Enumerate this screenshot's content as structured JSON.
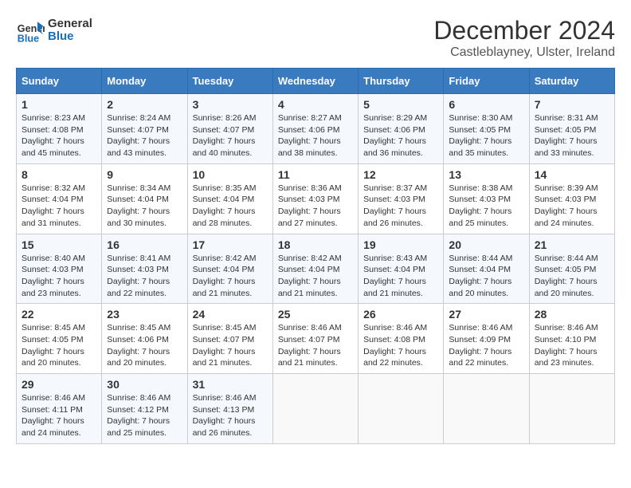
{
  "header": {
    "logo_line1": "General",
    "logo_line2": "Blue",
    "title": "December 2024",
    "subtitle": "Castleblayney, Ulster, Ireland"
  },
  "days_of_week": [
    "Sunday",
    "Monday",
    "Tuesday",
    "Wednesday",
    "Thursday",
    "Friday",
    "Saturday"
  ],
  "weeks": [
    [
      {
        "day": "1",
        "sunrise": "Sunrise: 8:23 AM",
        "sunset": "Sunset: 4:08 PM",
        "daylight": "Daylight: 7 hours and 45 minutes."
      },
      {
        "day": "2",
        "sunrise": "Sunrise: 8:24 AM",
        "sunset": "Sunset: 4:07 PM",
        "daylight": "Daylight: 7 hours and 43 minutes."
      },
      {
        "day": "3",
        "sunrise": "Sunrise: 8:26 AM",
        "sunset": "Sunset: 4:07 PM",
        "daylight": "Daylight: 7 hours and 40 minutes."
      },
      {
        "day": "4",
        "sunrise": "Sunrise: 8:27 AM",
        "sunset": "Sunset: 4:06 PM",
        "daylight": "Daylight: 7 hours and 38 minutes."
      },
      {
        "day": "5",
        "sunrise": "Sunrise: 8:29 AM",
        "sunset": "Sunset: 4:06 PM",
        "daylight": "Daylight: 7 hours and 36 minutes."
      },
      {
        "day": "6",
        "sunrise": "Sunrise: 8:30 AM",
        "sunset": "Sunset: 4:05 PM",
        "daylight": "Daylight: 7 hours and 35 minutes."
      },
      {
        "day": "7",
        "sunrise": "Sunrise: 8:31 AM",
        "sunset": "Sunset: 4:05 PM",
        "daylight": "Daylight: 7 hours and 33 minutes."
      }
    ],
    [
      {
        "day": "8",
        "sunrise": "Sunrise: 8:32 AM",
        "sunset": "Sunset: 4:04 PM",
        "daylight": "Daylight: 7 hours and 31 minutes."
      },
      {
        "day": "9",
        "sunrise": "Sunrise: 8:34 AM",
        "sunset": "Sunset: 4:04 PM",
        "daylight": "Daylight: 7 hours and 30 minutes."
      },
      {
        "day": "10",
        "sunrise": "Sunrise: 8:35 AM",
        "sunset": "Sunset: 4:04 PM",
        "daylight": "Daylight: 7 hours and 28 minutes."
      },
      {
        "day": "11",
        "sunrise": "Sunrise: 8:36 AM",
        "sunset": "Sunset: 4:03 PM",
        "daylight": "Daylight: 7 hours and 27 minutes."
      },
      {
        "day": "12",
        "sunrise": "Sunrise: 8:37 AM",
        "sunset": "Sunset: 4:03 PM",
        "daylight": "Daylight: 7 hours and 26 minutes."
      },
      {
        "day": "13",
        "sunrise": "Sunrise: 8:38 AM",
        "sunset": "Sunset: 4:03 PM",
        "daylight": "Daylight: 7 hours and 25 minutes."
      },
      {
        "day": "14",
        "sunrise": "Sunrise: 8:39 AM",
        "sunset": "Sunset: 4:03 PM",
        "daylight": "Daylight: 7 hours and 24 minutes."
      }
    ],
    [
      {
        "day": "15",
        "sunrise": "Sunrise: 8:40 AM",
        "sunset": "Sunset: 4:03 PM",
        "daylight": "Daylight: 7 hours and 23 minutes."
      },
      {
        "day": "16",
        "sunrise": "Sunrise: 8:41 AM",
        "sunset": "Sunset: 4:03 PM",
        "daylight": "Daylight: 7 hours and 22 minutes."
      },
      {
        "day": "17",
        "sunrise": "Sunrise: 8:42 AM",
        "sunset": "Sunset: 4:04 PM",
        "daylight": "Daylight: 7 hours and 21 minutes."
      },
      {
        "day": "18",
        "sunrise": "Sunrise: 8:42 AM",
        "sunset": "Sunset: 4:04 PM",
        "daylight": "Daylight: 7 hours and 21 minutes."
      },
      {
        "day": "19",
        "sunrise": "Sunrise: 8:43 AM",
        "sunset": "Sunset: 4:04 PM",
        "daylight": "Daylight: 7 hours and 21 minutes."
      },
      {
        "day": "20",
        "sunrise": "Sunrise: 8:44 AM",
        "sunset": "Sunset: 4:04 PM",
        "daylight": "Daylight: 7 hours and 20 minutes."
      },
      {
        "day": "21",
        "sunrise": "Sunrise: 8:44 AM",
        "sunset": "Sunset: 4:05 PM",
        "daylight": "Daylight: 7 hours and 20 minutes."
      }
    ],
    [
      {
        "day": "22",
        "sunrise": "Sunrise: 8:45 AM",
        "sunset": "Sunset: 4:05 PM",
        "daylight": "Daylight: 7 hours and 20 minutes."
      },
      {
        "day": "23",
        "sunrise": "Sunrise: 8:45 AM",
        "sunset": "Sunset: 4:06 PM",
        "daylight": "Daylight: 7 hours and 20 minutes."
      },
      {
        "day": "24",
        "sunrise": "Sunrise: 8:45 AM",
        "sunset": "Sunset: 4:07 PM",
        "daylight": "Daylight: 7 hours and 21 minutes."
      },
      {
        "day": "25",
        "sunrise": "Sunrise: 8:46 AM",
        "sunset": "Sunset: 4:07 PM",
        "daylight": "Daylight: 7 hours and 21 minutes."
      },
      {
        "day": "26",
        "sunrise": "Sunrise: 8:46 AM",
        "sunset": "Sunset: 4:08 PM",
        "daylight": "Daylight: 7 hours and 22 minutes."
      },
      {
        "day": "27",
        "sunrise": "Sunrise: 8:46 AM",
        "sunset": "Sunset: 4:09 PM",
        "daylight": "Daylight: 7 hours and 22 minutes."
      },
      {
        "day": "28",
        "sunrise": "Sunrise: 8:46 AM",
        "sunset": "Sunset: 4:10 PM",
        "daylight": "Daylight: 7 hours and 23 minutes."
      }
    ],
    [
      {
        "day": "29",
        "sunrise": "Sunrise: 8:46 AM",
        "sunset": "Sunset: 4:11 PM",
        "daylight": "Daylight: 7 hours and 24 minutes."
      },
      {
        "day": "30",
        "sunrise": "Sunrise: 8:46 AM",
        "sunset": "Sunset: 4:12 PM",
        "daylight": "Daylight: 7 hours and 25 minutes."
      },
      {
        "day": "31",
        "sunrise": "Sunrise: 8:46 AM",
        "sunset": "Sunset: 4:13 PM",
        "daylight": "Daylight: 7 hours and 26 minutes."
      },
      null,
      null,
      null,
      null
    ]
  ]
}
